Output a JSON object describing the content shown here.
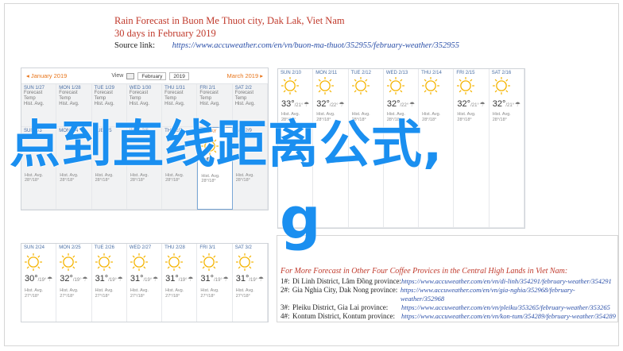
{
  "header": {
    "title": "Rain Forecast in Buon Me Thuot city, Dak Lak, Viet Nam",
    "subtitle": "30 days in February 2019",
    "source_label": "Source link:",
    "source_url": "https://www.accuweather.com/en/vn/buon-ma-thuot/352955/february-weather/352955"
  },
  "calendar_left": {
    "prev_label": "◂ January 2019",
    "view_label": "View",
    "month_select": "February",
    "year_select": "2019",
    "next_label": "March 2019 ▸",
    "days": [
      {
        "day": "SUN 1/27",
        "hl": "Forecast Temp",
        "lo": "Hist. Avg.",
        "shaded": true
      },
      {
        "day": "MON 1/28",
        "hl": "Forecast Temp",
        "lo": "Hist. Avg.",
        "shaded": true
      },
      {
        "day": "TUE 1/29",
        "hl": "Forecast Temp",
        "lo": "Hist. Avg.",
        "shaded": true
      },
      {
        "day": "WED 1/30",
        "hl": "Forecast Temp",
        "lo": "Hist. Avg.",
        "shaded": true
      },
      {
        "day": "THU 1/31",
        "hl": "Forecast Temp",
        "lo": "Hist. Avg.",
        "shaded": true
      },
      {
        "day": "FRI 2/1",
        "hl": "Forecast Temp",
        "lo": "Hist. Avg.",
        "shaded": true
      },
      {
        "day": "SAT 2/2",
        "hl": "Forecast Temp",
        "lo": "Hist. Avg.",
        "shaded": true
      }
    ],
    "week2": [
      {
        "day": "SUN 2/3",
        "temp": "",
        "avg": "Hist. Avg. 28°/18°"
      },
      {
        "day": "MON 2/4",
        "temp": "",
        "avg": "Hist. Avg. 28°/18°"
      },
      {
        "day": "TUE 2/5",
        "temp": "",
        "avg": "Hist. Avg. 28°/18°"
      },
      {
        "day": "WED 2/6",
        "temp": "",
        "avg": "Hist. Avg. 28°/18°"
      },
      {
        "day": "THU 2/7",
        "temp": "",
        "avg": "Hist. Avg. 28°/18°"
      },
      {
        "day": "TODAY",
        "temp": "35°",
        "avg": "Hist. Avg. 28°/18°"
      },
      {
        "day": "SAT 2/9",
        "temp": "",
        "avg": "Hist. Avg. 28°/18°"
      }
    ]
  },
  "calendar_right": {
    "days": [
      {
        "day": "SUN 2/10",
        "temp": "33°",
        "low": "/21°",
        "ra": "Hist. Avg. 28°/18°"
      },
      {
        "day": "MON 2/11",
        "temp": "32°",
        "low": "/22°",
        "ra": "Hist. Avg. 28°/18°"
      },
      {
        "day": "TUE 2/12",
        "temp": "",
        "low": "",
        "ra": "Hist. Avg. 28°/18°"
      },
      {
        "day": "WED 2/13",
        "temp": "32°",
        "low": "/22°",
        "ra": "Hist. Avg. 28°/18°"
      },
      {
        "day": "THU 2/14",
        "temp": "",
        "low": "",
        "ra": "Hist. Avg. 28°/18°"
      },
      {
        "day": "FRI 2/15",
        "temp": "32°",
        "low": "/21°",
        "ra": "Hist. Avg. 28°/18°"
      },
      {
        "day": "SAT 2/16",
        "temp": "32°",
        "low": "/21°",
        "ra": "Hist. Avg. 28°/18°"
      }
    ]
  },
  "calendar_bottom": {
    "days": [
      {
        "day": "SUN 2/24",
        "temp": "30°",
        "low": "/19°",
        "ra": "Hist. Avg. 27°/18°"
      },
      {
        "day": "MON 2/25",
        "temp": "32°",
        "low": "/19°",
        "ra": "Hist. Avg. 27°/18°"
      },
      {
        "day": "TUE 2/26",
        "temp": "31°",
        "low": "/19°",
        "ra": "Hist. Avg. 27°/18°"
      },
      {
        "day": "WED 2/27",
        "temp": "31°",
        "low": "/19°",
        "ra": "Hist. Avg. 27°/18°"
      },
      {
        "day": "THU 2/28",
        "temp": "31°",
        "low": "/19°",
        "ra": "Hist. Avg. 27°/18°"
      },
      {
        "day": "FRI 3/1",
        "temp": "31°",
        "low": "/19°",
        "ra": "Hist. Avg. 27°/18°"
      },
      {
        "day": "SAT 3/2",
        "temp": "31°",
        "low": "/19°",
        "ra": "Hist. Avg. 27°/18°"
      }
    ]
  },
  "more_forecast": {
    "title": "For More Forecast in Other Four Coffee Provices in the Central High Lands in Viet Nam:",
    "rows": [
      {
        "num": "1#:",
        "place": "Di Linh District, Lâm Đồng province:",
        "url": "https://www.accuweather.com/en/vn/di-linh/354291/february-weather/354291"
      },
      {
        "num": "2#:",
        "place": "Gia Nghia City, Dak Nong province:",
        "url": "https://www.accuweather.com/en/vn/gia-nghia/352968/february-weather/352968"
      },
      {
        "num": "3#:",
        "place": "Pleiku District, Gia Lai province:",
        "url": "https://www.accuweather.com/en/vn/pleiku/353265/february-weather/353265"
      },
      {
        "num": "4#:",
        "place": "Kontum District, Kontum province:",
        "url": "https://www.accuweather.com/en/vn/kon-tum/354289/february-weather/354289"
      }
    ]
  },
  "watermark": {
    "line1": "点到直线距离公式,",
    "line2": "g",
    "color": "#1a8ff0"
  },
  "colors": {
    "accent_orange": "#e8751a",
    "title_red": "#c0392b",
    "link_blue": "#2a4fa8",
    "sun_yellow": "#f5b400"
  }
}
